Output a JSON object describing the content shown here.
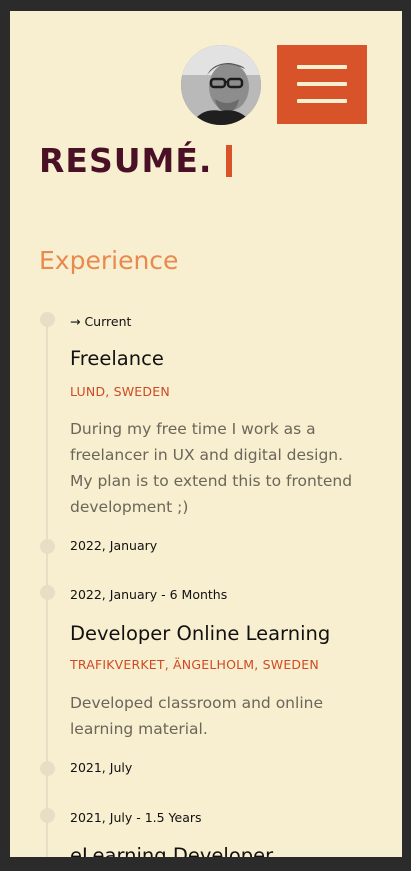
{
  "header": {
    "avatar_alt": "Profile photo",
    "menu_icon": "hamburger-menu-icon"
  },
  "page": {
    "title": "RESUMÉ."
  },
  "experience": {
    "heading": "Experience",
    "entries": [
      {
        "start": "→ Current",
        "title": "Freelance",
        "location": "LUND, SWEDEN",
        "description": "During my free time I work as a freelancer in UX and digital design. My plan is to extend this to frontend development ;)",
        "end": "2022, January"
      },
      {
        "start": "2022, January - 6 Months",
        "title": "Developer Online Learning",
        "location": "TRAFIKVERKET, ÄNGELHOLM, SWEDEN",
        "description": "Developed classroom and online learning material.",
        "end": "2021, July"
      },
      {
        "start": "2021, July - 1.5 Years",
        "title": "eLearning Developer"
      }
    ]
  },
  "colors": {
    "background": "#f7efcf",
    "accent": "#d9532a",
    "title": "#4a1026",
    "heading": "#e88a4f",
    "frame": "#2b2b2b"
  }
}
